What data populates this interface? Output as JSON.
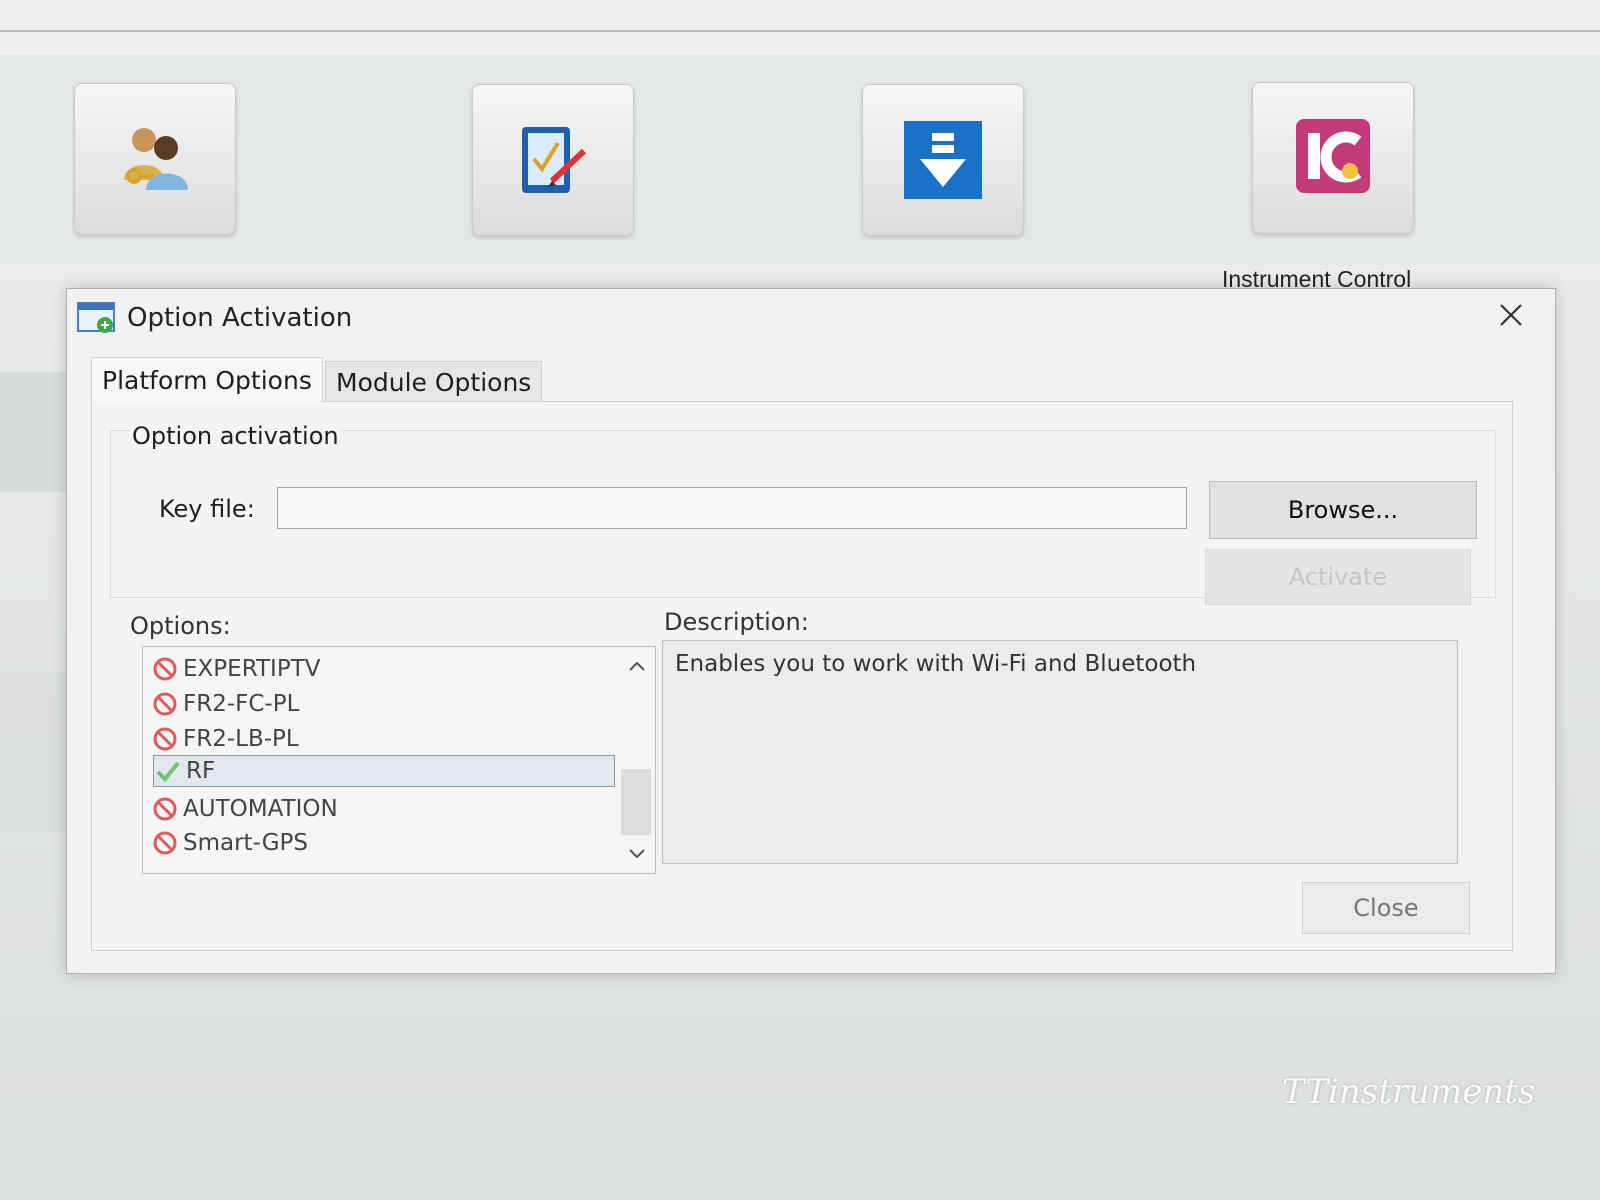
{
  "launcher": {
    "caption": "Instrument Control"
  },
  "dialog": {
    "title": "Option Activation",
    "tabs": [
      {
        "label": "Platform Options",
        "active": true
      },
      {
        "label": "Module Options",
        "active": false
      }
    ],
    "activation_group": {
      "title": "Option activation",
      "key_file_label": "Key file:",
      "key_file_value": "",
      "browse_label": "Browse...",
      "activate_label": "Activate"
    },
    "options_label": "Options:",
    "options": [
      {
        "label": "EXPERTIPTV",
        "status": "disabled",
        "icon": "prohibited-icon"
      },
      {
        "label": "FR2-FC-PL",
        "status": "disabled",
        "icon": "prohibited-icon"
      },
      {
        "label": "FR2-LB-PL",
        "status": "disabled",
        "icon": "prohibited-icon"
      },
      {
        "label": "RF",
        "status": "enabled",
        "icon": "checkmark-icon",
        "selected": true
      },
      {
        "label": "AUTOMATION",
        "status": "disabled",
        "icon": "prohibited-icon"
      },
      {
        "label": "Smart-GPS",
        "status": "disabled",
        "icon": "prohibited-icon"
      }
    ],
    "description_label": "Description:",
    "description_text": "Enables you to work with Wi-Fi and Bluetooth",
    "close_label": "Close"
  },
  "watermark": "TTinstruments",
  "colors": {
    "prohibited": "#e05a5a",
    "check": "#6cc56c",
    "download_blue": "#1a72c8",
    "ic_pink": "#c23a78"
  }
}
